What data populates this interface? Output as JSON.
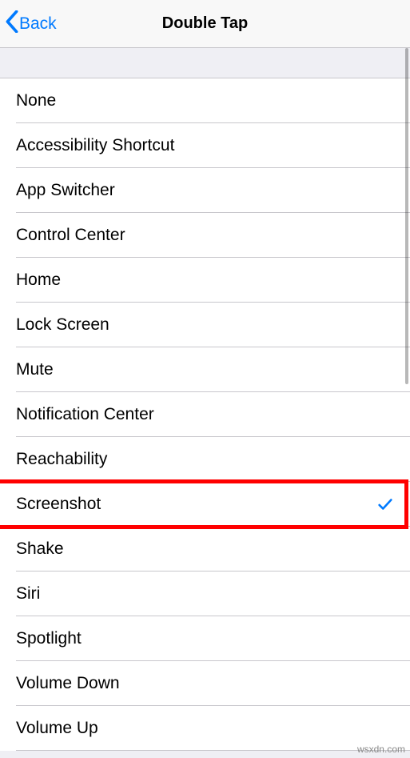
{
  "nav": {
    "back_label": "Back",
    "title": "Double Tap"
  },
  "options": [
    {
      "label": "None",
      "selected": false
    },
    {
      "label": "Accessibility Shortcut",
      "selected": false
    },
    {
      "label": "App Switcher",
      "selected": false
    },
    {
      "label": "Control Center",
      "selected": false
    },
    {
      "label": "Home",
      "selected": false
    },
    {
      "label": "Lock Screen",
      "selected": false
    },
    {
      "label": "Mute",
      "selected": false
    },
    {
      "label": "Notification Center",
      "selected": false
    },
    {
      "label": "Reachability",
      "selected": false
    },
    {
      "label": "Screenshot",
      "selected": true,
      "highlighted": true
    },
    {
      "label": "Shake",
      "selected": false
    },
    {
      "label": "Siri",
      "selected": false
    },
    {
      "label": "Spotlight",
      "selected": false
    },
    {
      "label": "Volume Down",
      "selected": false
    },
    {
      "label": "Volume Up",
      "selected": false
    }
  ],
  "watermark": "wsxdn.com"
}
